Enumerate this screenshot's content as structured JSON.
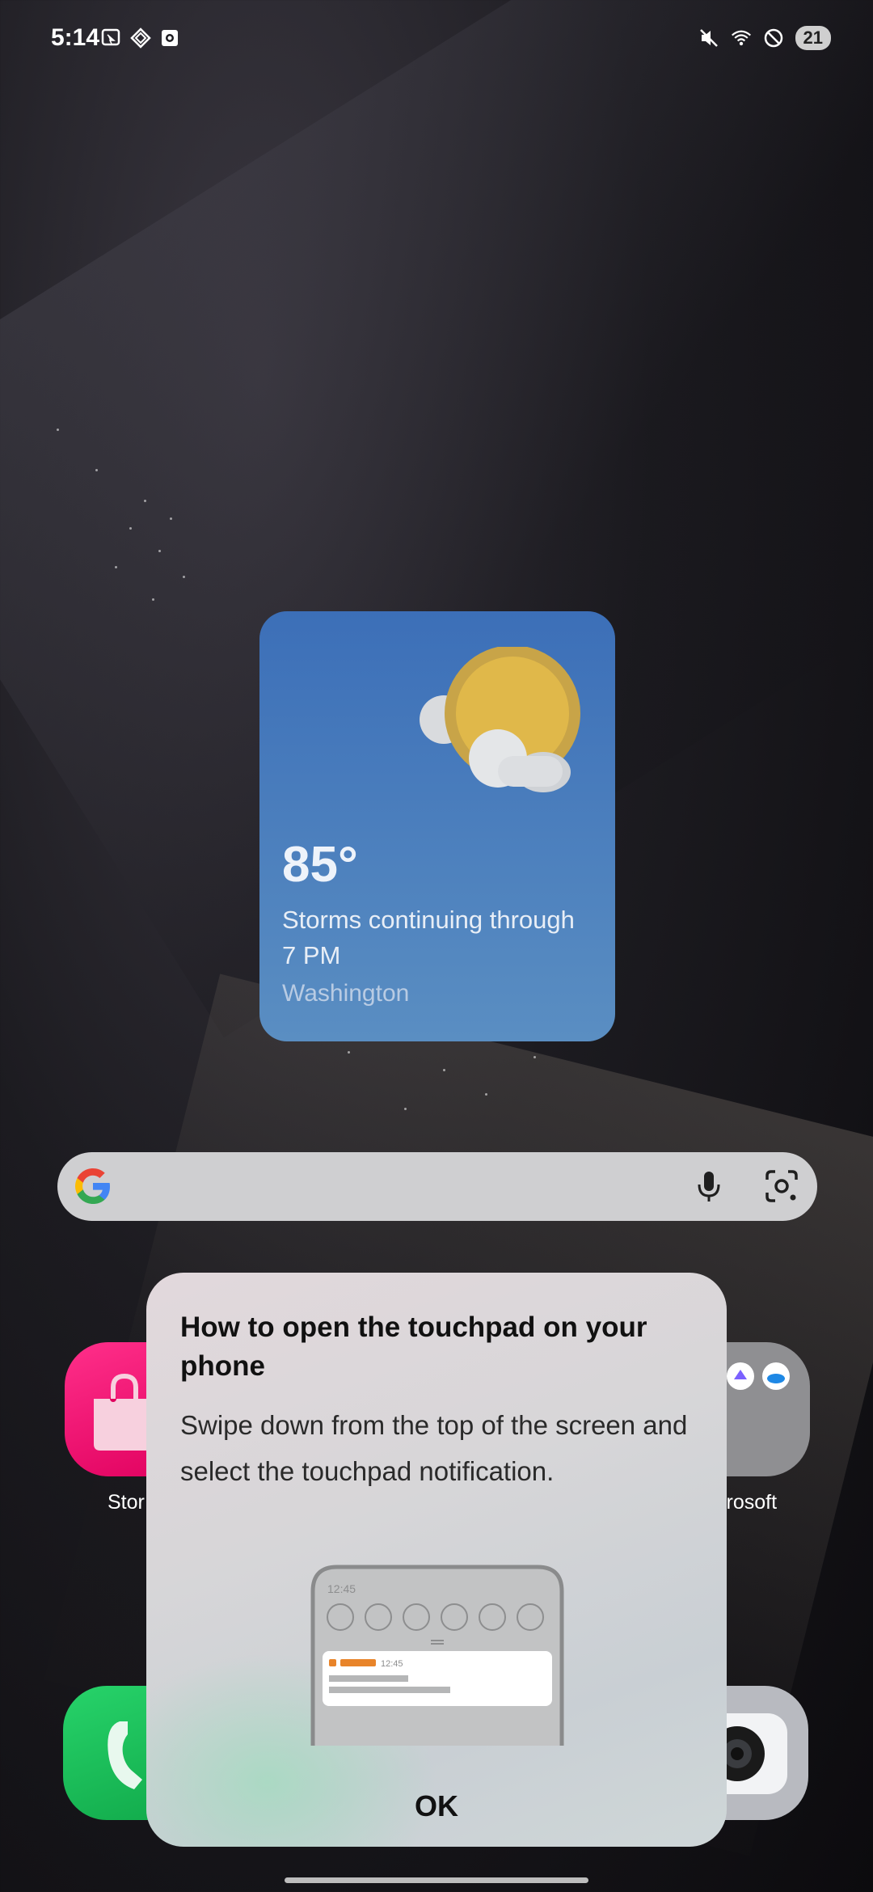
{
  "status_bar": {
    "time": "5:14",
    "battery": "21"
  },
  "weather": {
    "temperature": "85°",
    "condition": "Storms continuing through 7 PM",
    "location": "Washington"
  },
  "apps": {
    "store_label": "Stor",
    "microsoft_label": "crosoft"
  },
  "dialog": {
    "title": "How to open the touchpad on your phone",
    "body": "Swipe down from the top of the screen and select the touchpad notification.",
    "illustration": {
      "clock": "12:45",
      "notification_time": "12:45"
    },
    "ok_label": "OK"
  },
  "colors": {
    "weather_top": "#3c6fb8",
    "weather_bottom": "#5a8ec2",
    "sun": "#e0b84a",
    "accent_orange": "#e8842a"
  }
}
